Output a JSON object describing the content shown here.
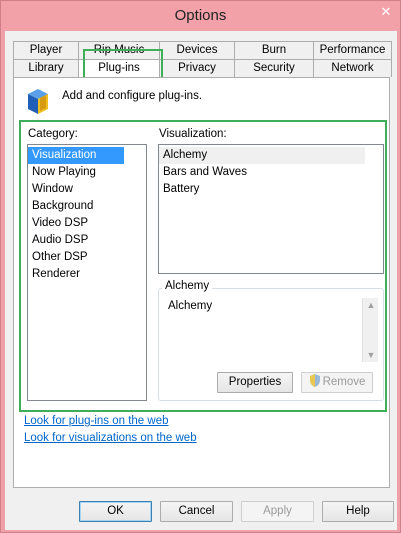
{
  "window": {
    "title": "Options",
    "close_glyph": "✕"
  },
  "tabs": {
    "row1": [
      "Player",
      "Rip Music",
      "Devices",
      "Burn",
      "Performance"
    ],
    "row2": [
      "Library",
      "Plug-ins",
      "Privacy",
      "Security",
      "Network"
    ],
    "active": "Plug-ins"
  },
  "header": {
    "text": "Add and configure plug-ins.",
    "icon": "plugin-box-icon"
  },
  "category": {
    "label": "Category:",
    "items": [
      "Visualization",
      "Now Playing",
      "Window",
      "Background",
      "Video DSP",
      "Audio DSP",
      "Other DSP",
      "Renderer"
    ],
    "selected": "Visualization"
  },
  "visualization": {
    "label": "Visualization:",
    "items": [
      "Alchemy",
      "Bars and Waves",
      "Battery"
    ],
    "selected": "Alchemy"
  },
  "details": {
    "group_title": "Alchemy",
    "description": "Alchemy",
    "properties_label": "Properties",
    "remove_label": "Remove"
  },
  "links": {
    "plugins": "Look for plug-ins on the web",
    "visualizations": "Look for visualizations on the web"
  },
  "buttons": {
    "ok": "OK",
    "cancel": "Cancel",
    "apply": "Apply",
    "help": "Help"
  },
  "colors": {
    "highlight": "#3fae5a",
    "selection": "#3399ff",
    "link": "#0066cc",
    "titlebar": "#f2a1a9"
  }
}
